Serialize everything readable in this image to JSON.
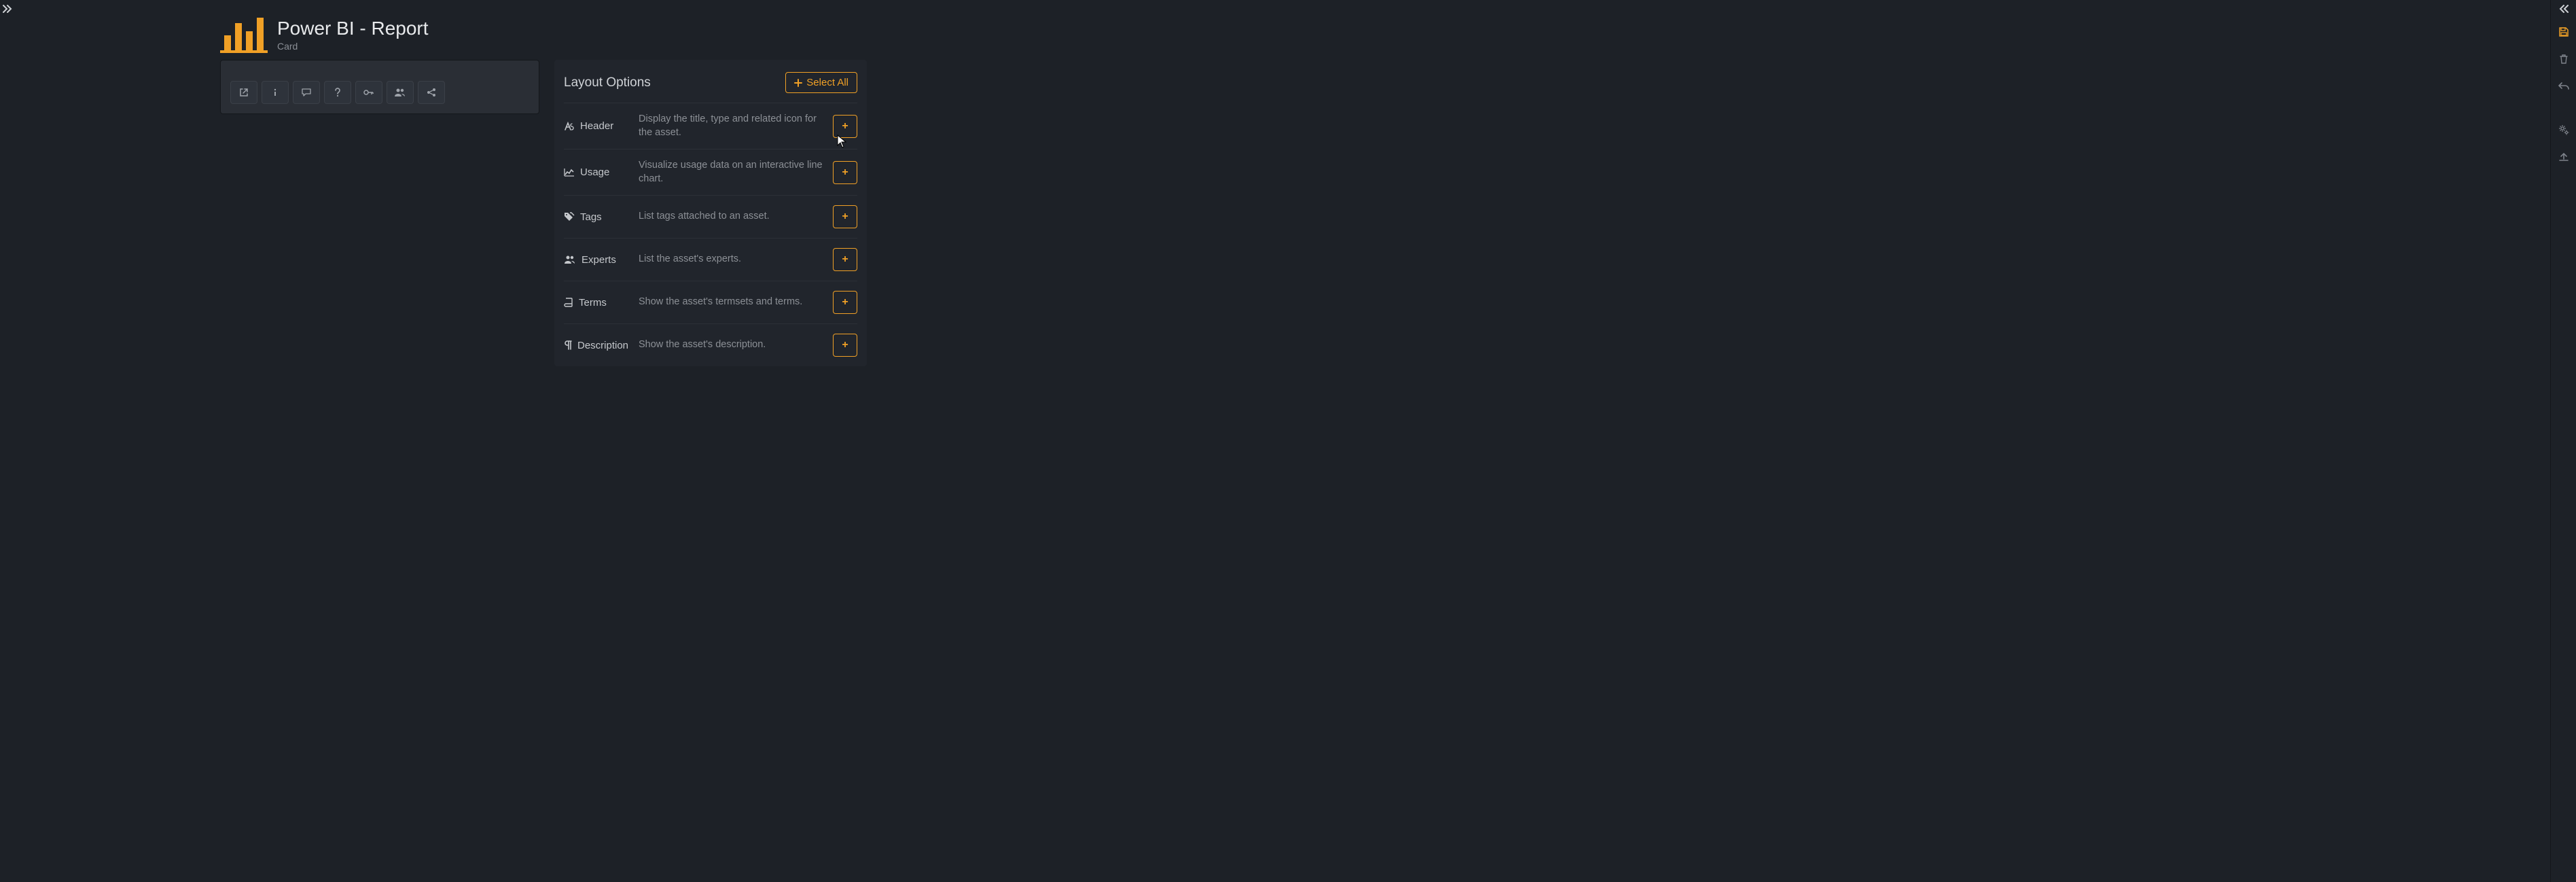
{
  "header": {
    "title": "Power BI - Report",
    "subtitle": "Card"
  },
  "toolbar": {
    "buttons": [
      {
        "name": "open-external-button",
        "icon": "external"
      },
      {
        "name": "info-button",
        "icon": "info"
      },
      {
        "name": "comment-button",
        "icon": "comment"
      },
      {
        "name": "help-button",
        "icon": "help"
      },
      {
        "name": "key-button",
        "icon": "key"
      },
      {
        "name": "users-button",
        "icon": "users"
      },
      {
        "name": "share-button",
        "icon": "share"
      }
    ]
  },
  "layoutPanel": {
    "title": "Layout Options",
    "selectAll": "Select All",
    "options": [
      {
        "icon": "font",
        "label": "Header",
        "desc": "Display the title, type and related icon for the asset."
      },
      {
        "icon": "linechart",
        "label": "Usage",
        "desc": "Visualize usage data on an interactive line chart."
      },
      {
        "icon": "tags",
        "label": "Tags",
        "desc": "List tags attached to an asset."
      },
      {
        "icon": "users",
        "label": "Experts",
        "desc": "List the asset's experts."
      },
      {
        "icon": "book",
        "label": "Terms",
        "desc": "Show the asset's termsets and terms."
      },
      {
        "icon": "pilcrow",
        "label": "Description",
        "desc": "Show the asset's description."
      }
    ]
  },
  "rightRail": {
    "buttons": [
      {
        "name": "save-button",
        "icon": "save",
        "active": true
      },
      {
        "name": "delete-button",
        "icon": "trash",
        "active": false
      },
      {
        "name": "undo-button",
        "icon": "undo",
        "active": false
      },
      {
        "name": "settings-button",
        "icon": "gears",
        "active": false
      },
      {
        "name": "upload-button",
        "icon": "upload",
        "active": false
      }
    ]
  }
}
